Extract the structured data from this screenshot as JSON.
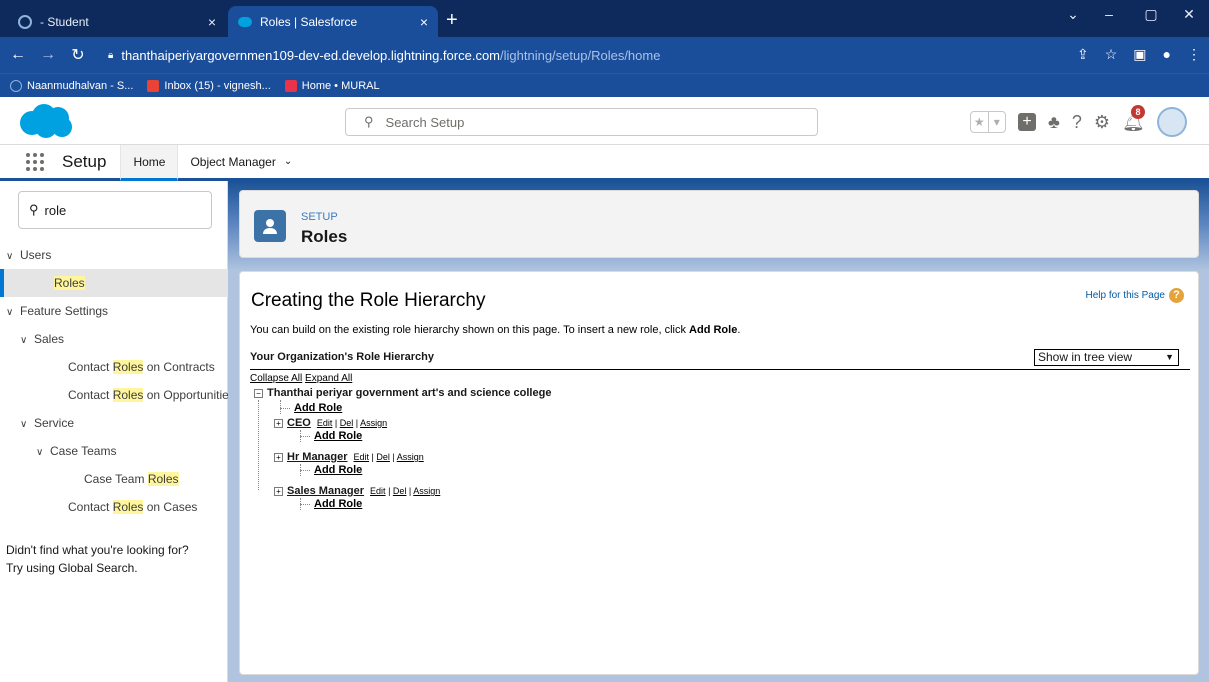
{
  "browser": {
    "tabs": [
      {
        "title": "- Student",
        "close": "×"
      },
      {
        "title": "Roles | Salesforce",
        "close": "×"
      }
    ],
    "new_tab": "+",
    "window_controls": [
      "⌄",
      "–",
      "▢",
      "✕"
    ],
    "url_host": "thanthaiperiyargovernmen109-dev-ed.develop.lightning.force.com",
    "url_path": "/lightning/setup/Roles/home",
    "bookmarks": [
      {
        "label": "Naanmudhalvan - S...",
        "color": "#5f88c2"
      },
      {
        "label": "Inbox (15) - vignesh...",
        "color": "#ea4335"
      },
      {
        "label": "Home • MURAL",
        "color": "#e8334a"
      }
    ]
  },
  "sf_header": {
    "search_placeholder": "Search Setup",
    "notification_count": "8"
  },
  "context_bar": {
    "app_name": "Setup",
    "tabs": [
      "Home",
      "Object Manager"
    ]
  },
  "sidebar": {
    "quick_find_value": "role",
    "items": [
      {
        "pre": "",
        "hl": "",
        "post": "Users",
        "level": 0,
        "chevron": true
      },
      {
        "pre": "",
        "hl": "Roles",
        "post": "",
        "level": 2,
        "chevron": false,
        "selected": true
      },
      {
        "pre": "",
        "hl": "",
        "post": "Feature Settings",
        "level": 0,
        "chevron": true
      },
      {
        "pre": "",
        "hl": "",
        "post": "Sales",
        "level": 1,
        "chevron": true
      },
      {
        "pre": "Contact ",
        "hl": "Roles",
        "post": " on Contracts",
        "level": 3,
        "chevron": false
      },
      {
        "pre": "Contact ",
        "hl": "Roles",
        "post": " on Opportunities",
        "level": 3,
        "chevron": false
      },
      {
        "pre": "",
        "hl": "",
        "post": "Service",
        "level": 1,
        "chevron": true
      },
      {
        "pre": "",
        "hl": "",
        "post": "Case Teams",
        "level": 2,
        "chevron": true
      },
      {
        "pre": "Case Team ",
        "hl": "Roles",
        "post": "",
        "level": 4,
        "chevron": false
      },
      {
        "pre": "Contact ",
        "hl": "Roles",
        "post": " on Cases",
        "level": 3,
        "chevron": false
      }
    ],
    "not_found_line1": "Didn't find what you're looking for?",
    "not_found_line2": "Try using Global Search."
  },
  "page_header": {
    "overline": "SETUP",
    "title": "Roles"
  },
  "content": {
    "title": "Creating the Role Hierarchy",
    "help_link": "Help for this Page",
    "description_prefix": "You can build on the existing role hierarchy shown on this page. To insert a new role, click ",
    "description_bold": "Add Role",
    "description_suffix": ".",
    "hierarchy_label": "Your Organization's Role Hierarchy",
    "view_select": "Show in tree view",
    "collapse_all": "Collapse All",
    "expand_all": "Expand All",
    "root": "Thanthai periyar government art's and science college",
    "add_role": "Add Role",
    "edit": "Edit",
    "del": "Del",
    "assign": "Assign",
    "roles": [
      "CEO",
      "Hr Manager",
      "Sales Manager"
    ]
  }
}
